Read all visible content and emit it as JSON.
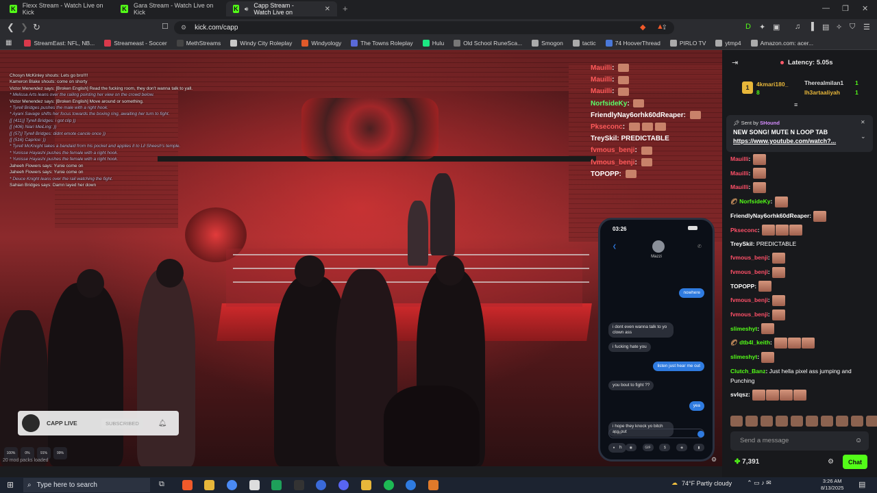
{
  "browser": {
    "tabs": [
      {
        "label": "Flexx Stream - Watch Live on Kick",
        "active": false
      },
      {
        "label": "Gara Stream - Watch Live on Kick",
        "active": false
      },
      {
        "label": "Capp Stream - Watch Live on",
        "active": true
      }
    ],
    "url": "kick.com/capp",
    "bookmarks": [
      {
        "label": "StreamEast: NFL, NB...",
        "color": "#d9394b"
      },
      {
        "label": "Streameast - Soccer",
        "color": "#d9394b"
      },
      {
        "label": "MethStreams",
        "color": "#444"
      },
      {
        "label": "Windy City Roleplay",
        "color": "#c8c8c8"
      },
      {
        "label": "Windyology",
        "color": "#e05a2a"
      },
      {
        "label": "The Towns Roleplay",
        "color": "#5a6ad9"
      },
      {
        "label": "Hulu",
        "color": "#1ce783"
      },
      {
        "label": "Old School RuneSca...",
        "color": "#777"
      },
      {
        "label": "Smogon",
        "color": "#aaa"
      },
      {
        "label": "tactic",
        "color": "#aaa"
      },
      {
        "label": "74 HooverThread",
        "color": "#4a78d9"
      },
      {
        "label": "PIRLO TV",
        "color": "#aaa"
      },
      {
        "label": "ytmp4",
        "color": "#aaa"
      },
      {
        "label": "Amazon.com: acer...",
        "color": "#aaa"
      }
    ]
  },
  "stream": {
    "game_chat": [
      "Chosyn McKinley shouts: Lets go bro!!!!",
      "Kameron Blake shouts: come on shorty",
      "Victor Menendez says: [Broken English] Read the fucking room, they don't wanna talk to yall.",
      "* Melissa Arts leans over the railing pointing her view on the crowd below.",
      "Victor Menendez says: [Broken English] Move around or something.",
      "* Tyrell Bridges pushes the male with a right hook.",
      "* Ayani Savage shifts her focus towards the boxing ring, awaiting her turn to fight.",
      "[[ (411)] Tyrell Bridges: i got clip ))",
      "[[ (406) Niari MeiLing: ))",
      "[[ (57)] Tyrell Bridges: didnt emote cancle once ))",
      "[[ (516) Caprice: ))",
      "* Tyrell McKnight takes a bandaid from his pocket and applies it to Lil Sheesh's temple.",
      "* Yunisse Hayashi pushes the female with a right hook.",
      "* Yunisse Hayashi pushes the female with a right hook.",
      "Jaheeh Flowers says: Yunie come on",
      "Jaheeh Flowers says: Yunie come on",
      "* Deuce Knight leans over the rail watching the fight.",
      "Sahian Bridges says: Damn layed her down"
    ],
    "overlay_chat": [
      {
        "user": "Mauilli",
        "text": "",
        "color": "red",
        "emotes": 1
      },
      {
        "user": "Mauilli",
        "text": "",
        "color": "red",
        "emotes": 1
      },
      {
        "user": "Mauilli",
        "text": "",
        "color": "red",
        "emotes": 1
      },
      {
        "user": "NorfsideKy",
        "text": "",
        "color": "green",
        "emotes": 1
      },
      {
        "user": "FriendlyNay6orhk60dReaper",
        "text": "",
        "color": "white",
        "emotes": 1
      },
      {
        "user": "Pkseconc",
        "text": "",
        "color": "red",
        "emotes": 3
      },
      {
        "user": "TreySkil",
        "text": "PREDICTABLE",
        "color": "white",
        "emotes": 0
      },
      {
        "user": "fvmous_benji",
        "text": "",
        "color": "red",
        "emotes": 1
      },
      {
        "user": "fvmous_benji",
        "text": "",
        "color": "red",
        "emotes": 1
      },
      {
        "user": "TOPOPP",
        "text": "",
        "color": "white",
        "emotes": 1
      }
    ],
    "phone": {
      "time": "03:26",
      "contact": "Mazzi",
      "messages": [
        {
          "from": "me",
          "text": "nowhere"
        },
        {
          "from": "them",
          "text": "i dont even wanna talk to yo clown ass"
        },
        {
          "from": "them",
          "text": "i fucking hate you"
        },
        {
          "from": "me",
          "text": "listen just hear me out"
        },
        {
          "from": "them",
          "text": "you bout to fight ??"
        },
        {
          "from": "me",
          "text": "yea"
        },
        {
          "from": "them",
          "text": "i hope they knock yo bitch ass out"
        },
        {
          "from": "them",
          "text": "bitch"
        }
      ],
      "input_text": "i wil",
      "dock_labels": [
        "",
        "",
        "GIF",
        "$",
        "",
        ""
      ]
    },
    "info_card": {
      "name": "CAPP LIVE",
      "subscribed": "SUBSCRIBED"
    },
    "hud": [
      "100%",
      "0%",
      "91%",
      "99%"
    ],
    "mods_loaded": "20 mod packs loaded"
  },
  "chat": {
    "latency": "Latency: 5.05s",
    "leaderboard": [
      {
        "rank": "1",
        "name": "4kmari180_",
        "count": "8"
      },
      {
        "name": "Therealmilan1",
        "count": "1"
      },
      {
        "name": "Ih3artaaliyah",
        "count": "1"
      }
    ],
    "pinned": {
      "sent_by": "Sent by",
      "sender": "SHound",
      "message": "NEW SONG! MUTE N LOOP TAB",
      "link": "https://www.youtube.com/watch?..."
    },
    "messages": [
      {
        "user": "Mauilli",
        "text": "",
        "color": "red",
        "emotes": 1
      },
      {
        "user": "Mauilli",
        "text": "",
        "color": "red",
        "emotes": 1
      },
      {
        "user": "Mauilli",
        "text": "",
        "color": "red",
        "emotes": 1
      },
      {
        "user": "NorfsideKy",
        "text": "",
        "color": "green",
        "emotes": 1
      },
      {
        "user": "FriendlyNay6orhk60dReaper",
        "text": "",
        "color": "white",
        "emotes": 1
      },
      {
        "user": "Pkseconc",
        "text": "",
        "color": "red",
        "emotes": 3
      },
      {
        "user": "TreySkil",
        "text": "PREDICTABLE",
        "color": "white",
        "emotes": 0
      },
      {
        "user": "fvmous_benji",
        "text": "",
        "color": "red",
        "emotes": 1
      },
      {
        "user": "fvmous_benji",
        "text": "",
        "color": "red",
        "emotes": 1
      },
      {
        "user": "TOPOPP",
        "text": "",
        "color": "white",
        "emotes": 1
      },
      {
        "user": "fvmous_benji",
        "text": "",
        "color": "red",
        "emotes": 1
      },
      {
        "user": "fvmous_benji",
        "text": "",
        "color": "red",
        "emotes": 1
      },
      {
        "user": "slimeshyt",
        "text": "",
        "color": "green",
        "emotes": 1
      },
      {
        "user": "dtb4l_keith",
        "text": "",
        "color": "green",
        "emotes": 3
      },
      {
        "user": "slimeshyt",
        "text": "",
        "color": "green",
        "emotes": 1
      },
      {
        "user": "Clutch_Banz",
        "text": "Just hella pixel ass jumping and Punching",
        "color": "green",
        "emotes": 0
      },
      {
        "user": "svlqsz",
        "text": "",
        "color": "white",
        "emotes": 4
      }
    ],
    "send_placeholder": "Send a message",
    "points": "7,391",
    "chat_button": "Chat"
  },
  "taskbar": {
    "search_placeholder": "Type here to search",
    "weather": "74°F  Partly cloudy",
    "time": "3:26 AM",
    "date": "8/13/2025"
  },
  "colors": {
    "kick_green": "#53fc18",
    "chat_red": "#ff5068"
  }
}
